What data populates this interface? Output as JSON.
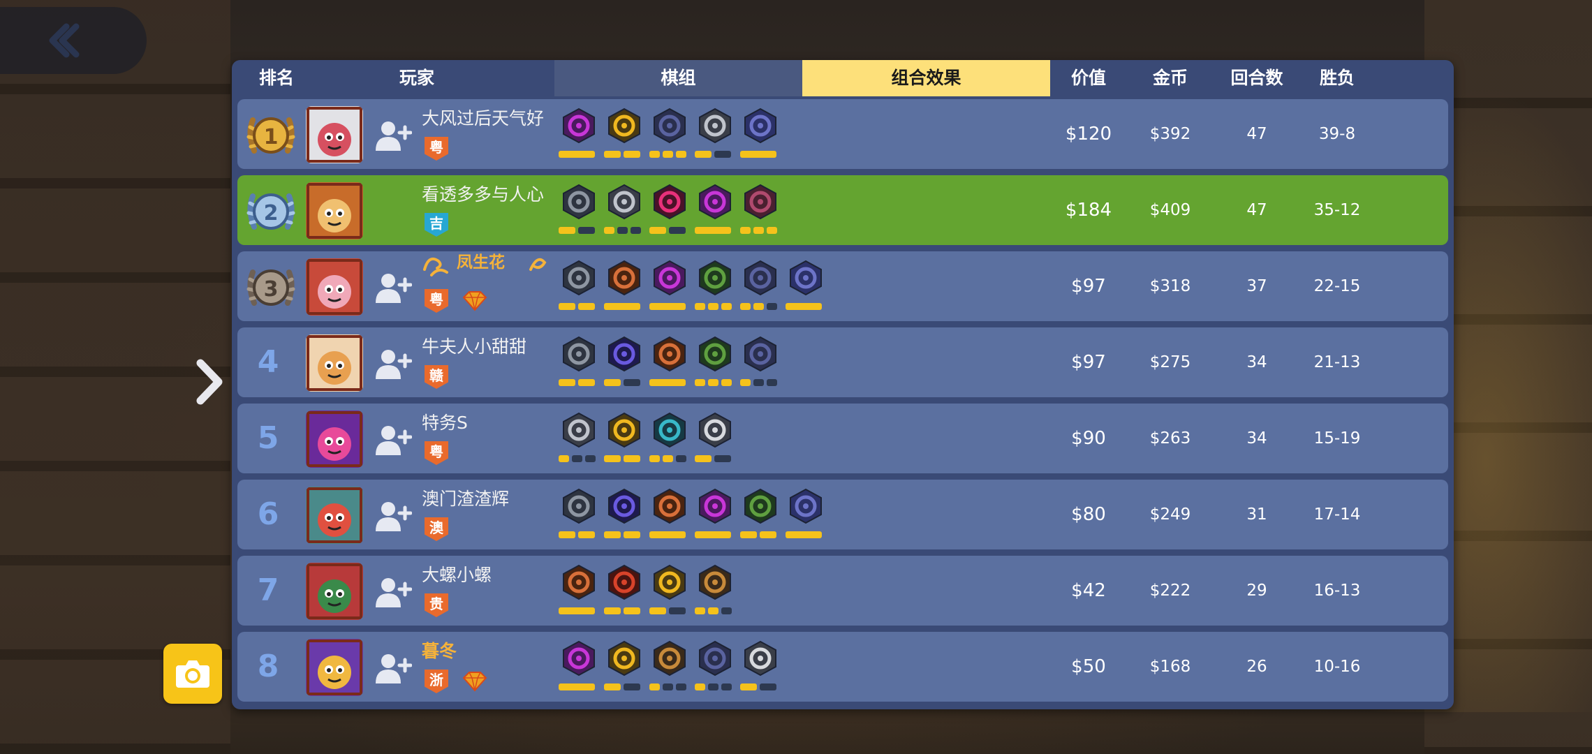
{
  "header": {
    "rank": "排名",
    "player": "玩家",
    "lineup": "棋组",
    "combo": "组合效果",
    "value": "价值",
    "gold": "金币",
    "rounds": "回合数",
    "winloss": "胜负"
  },
  "colors": {
    "row_default": "#5b70a0",
    "row_highlight": "#64a430",
    "panel": "#3a4a76",
    "combo_tab": "#fde07a",
    "bar_on": "#f5c21b",
    "bar_off": "#2d3950",
    "region_orange": "#e96a2c",
    "region_blue": "#27a7d3"
  },
  "icons": {
    "back": "back-chevron-icon",
    "next": "chevron-right-icon",
    "camera": "camera-icon",
    "add_friend": "add-friend-icon"
  },
  "rows": [
    {
      "rank": "1",
      "medal": "gold",
      "name": "大风过后天气好",
      "region": "粤",
      "region_color": "orange",
      "value": "$120",
      "gold": "$392",
      "rounds": "47",
      "record": "39-8",
      "traits": [
        {
          "c": "purple",
          "bars": [
            1,
            0
          ]
        },
        {
          "c": "gold",
          "bars": [
            2,
            2
          ]
        },
        {
          "c": "navy",
          "bars": [
            3,
            3
          ]
        },
        {
          "c": "grey",
          "bars": [
            1,
            2
          ]
        },
        {
          "c": "navy2",
          "bars": [
            1,
            1
          ]
        }
      ]
    },
    {
      "rank": "2",
      "medal": "silver",
      "name": "看透多多与人心",
      "region": "吉",
      "region_color": "blue",
      "value": "$184",
      "gold": "$409",
      "rounds": "47",
      "record": "35-12",
      "highlight": true,
      "traits": [
        {
          "c": "dark",
          "bars": [
            1,
            2
          ]
        },
        {
          "c": "grey",
          "bars": [
            1,
            3
          ]
        },
        {
          "c": "pink",
          "bars": [
            1,
            2
          ]
        },
        {
          "c": "purple",
          "bars": [
            1,
            1
          ]
        },
        {
          "c": "pink2",
          "bars": [
            3,
            3
          ]
        }
      ]
    },
    {
      "rank": "3",
      "medal": "bronze",
      "name": "凤生花",
      "gold_name": true,
      "region": "粤",
      "region_color": "orange",
      "gem": true,
      "value": "$97",
      "gold": "$318",
      "rounds": "37",
      "record": "22-15",
      "traits": [
        {
          "c": "dark",
          "bars": [
            2,
            2
          ]
        },
        {
          "c": "orange",
          "bars": [
            1,
            1
          ]
        },
        {
          "c": "purple",
          "bars": [
            1,
            1
          ]
        },
        {
          "c": "green",
          "bars": [
            3,
            3
          ]
        },
        {
          "c": "navy",
          "bars": [
            2,
            3
          ]
        },
        {
          "c": "navy2",
          "bars": [
            1,
            1
          ]
        }
      ]
    },
    {
      "rank": "4",
      "name": "牛夫人小甜甜",
      "region": "赣",
      "region_color": "orange",
      "value": "$97",
      "gold": "$275",
      "rounds": "34",
      "record": "21-13",
      "traits": [
        {
          "c": "dark",
          "bars": [
            2,
            2
          ]
        },
        {
          "c": "indigo",
          "bars": [
            1,
            2
          ]
        },
        {
          "c": "orange",
          "bars": [
            1,
            1
          ]
        },
        {
          "c": "green",
          "bars": [
            3,
            3
          ]
        },
        {
          "c": "navy",
          "bars": [
            1,
            3
          ]
        }
      ]
    },
    {
      "rank": "5",
      "name": "特务S",
      "region": "粤",
      "region_color": "orange",
      "value": "$90",
      "gold": "$263",
      "rounds": "34",
      "record": "15-19",
      "traits": [
        {
          "c": "grey",
          "bars": [
            1,
            3
          ]
        },
        {
          "c": "gold",
          "bars": [
            2,
            2
          ]
        },
        {
          "c": "teal",
          "bars": [
            2,
            3
          ]
        },
        {
          "c": "grey2",
          "bars": [
            1,
            2
          ]
        }
      ]
    },
    {
      "rank": "6",
      "name": "澳门渣渣辉",
      "region": "澳",
      "region_color": "orange",
      "value": "$80",
      "gold": "$249",
      "rounds": "31",
      "record": "17-14",
      "traits": [
        {
          "c": "dark",
          "bars": [
            2,
            2
          ]
        },
        {
          "c": "indigo",
          "bars": [
            2,
            2
          ]
        },
        {
          "c": "orange",
          "bars": [
            1,
            1
          ]
        },
        {
          "c": "purple",
          "bars": [
            1,
            1
          ]
        },
        {
          "c": "green",
          "bars": [
            2,
            2
          ]
        },
        {
          "c": "navy2",
          "bars": [
            1,
            1
          ]
        }
      ]
    },
    {
      "rank": "7",
      "name": "大螺小螺",
      "region": "贵",
      "region_color": "orange",
      "value": "$42",
      "gold": "$222",
      "rounds": "29",
      "record": "16-13",
      "traits": [
        {
          "c": "orange",
          "bars": [
            1,
            1
          ]
        },
        {
          "c": "red",
          "bars": [
            2,
            2
          ]
        },
        {
          "c": "gold",
          "bars": [
            1,
            2
          ]
        },
        {
          "c": "bronze",
          "bars": [
            2,
            3
          ]
        }
      ]
    },
    {
      "rank": "8",
      "name": "暮冬",
      "gold_name": true,
      "region": "浙",
      "region_color": "orange",
      "gem": true,
      "value": "$50",
      "gold": "$168",
      "rounds": "26",
      "record": "10-16",
      "traits": [
        {
          "c": "purple",
          "bars": [
            1,
            1
          ]
        },
        {
          "c": "gold",
          "bars": [
            1,
            2
          ]
        },
        {
          "c": "bronze",
          "bars": [
            1,
            3
          ]
        },
        {
          "c": "navy",
          "bars": [
            1,
            3
          ]
        },
        {
          "c": "grey2",
          "bars": [
            1,
            2
          ]
        }
      ]
    }
  ]
}
